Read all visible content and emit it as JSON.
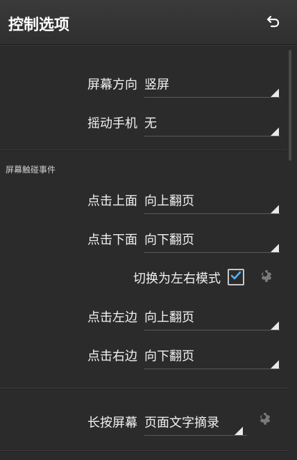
{
  "header": {
    "title": "控制选项",
    "back_icon": "back-icon"
  },
  "screen": {
    "orientation": {
      "label": "屏幕方向",
      "value": "竖屏"
    },
    "shake": {
      "label": "摇动手机",
      "value": "无"
    }
  },
  "touch_events": {
    "section_title": "屏幕触碰事件",
    "tap_top": {
      "label": "点击上面",
      "value": "向上翻页"
    },
    "tap_bottom": {
      "label": "点击下面",
      "value": "向下翻页"
    },
    "mode_switch": {
      "label": "切换为左右模式",
      "checked": true
    },
    "tap_left": {
      "label": "点击左边",
      "value": "向上翻页"
    },
    "tap_right": {
      "label": "点击右边",
      "value": "向下翻页"
    }
  },
  "long_press": {
    "label": "长按屏幕",
    "value": "页面文字摘录"
  },
  "colors": {
    "checkbox_check": "#4fb3ff",
    "gear": "#7a7a7a"
  }
}
